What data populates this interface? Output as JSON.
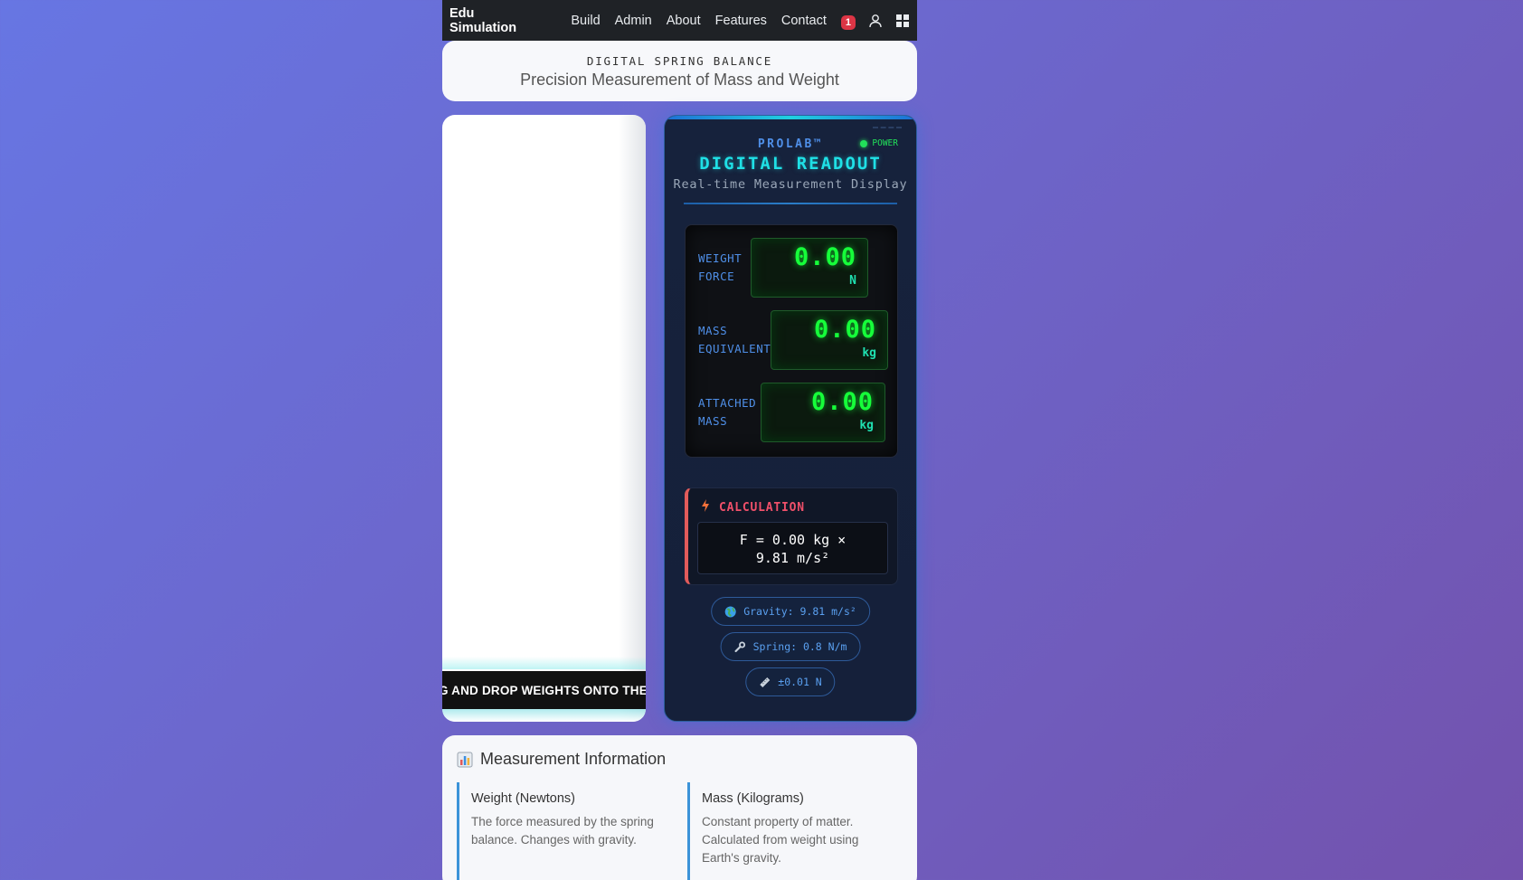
{
  "navbar": {
    "brand": "Edu Simulation",
    "links": [
      "Build",
      "Admin",
      "About",
      "Features",
      "Contact"
    ],
    "notification_count": "1"
  },
  "header": {
    "subtitle": "DIGITAL SPRING BALANCE",
    "title": "Precision Measurement of Mass and Weight"
  },
  "simulation": {
    "marquee_text": "G AND DROP WEIGHTS ONTO THE H"
  },
  "device": {
    "brand": "PROLAB™",
    "power_label": "POWER",
    "title": "DIGITAL READOUT",
    "subtitle": "Real-time Measurement Display",
    "readings": [
      {
        "label_line1": "WEIGHT",
        "label_line2": "FORCE",
        "value": "0.00",
        "unit": "N"
      },
      {
        "label_line1": "MASS",
        "label_line2": "EQUIVALENT",
        "value": "0.00",
        "unit": "kg"
      },
      {
        "label_line1": "ATTACHED",
        "label_line2": "MASS",
        "value": "0.00",
        "unit": "kg"
      }
    ],
    "calculation": {
      "label": "CALCULATION",
      "formula_line1": "F = 0.00 kg ×",
      "formula_line2": "9.81 m/s²"
    },
    "pills": {
      "gravity": "Gravity: 9.81 m/s²",
      "spring": "Spring: 0.8 N/m",
      "precision": "±0.01 N"
    }
  },
  "info": {
    "title": "Measurement Information",
    "columns": [
      {
        "title": "Weight (Newtons)",
        "text": "The force measured by the spring balance. Changes with gravity."
      },
      {
        "title": "Mass (Kilograms)",
        "text": "Constant property of matter. Calculated from weight using Earth's gravity."
      }
    ]
  },
  "colors": {
    "background_start": "#6776e3",
    "background_end": "#7352ad",
    "lcd_green": "#16ff3a",
    "accent_cyan": "#1fe0e6",
    "accent_red": "#e25b5b",
    "accent_blue": "#3b93d8"
  },
  "icons": [
    "bell-badge",
    "user-icon",
    "grid-icon",
    "bolt-icon",
    "globe-icon",
    "wrench-icon",
    "ruler-icon",
    "bar-chart-icon"
  ]
}
